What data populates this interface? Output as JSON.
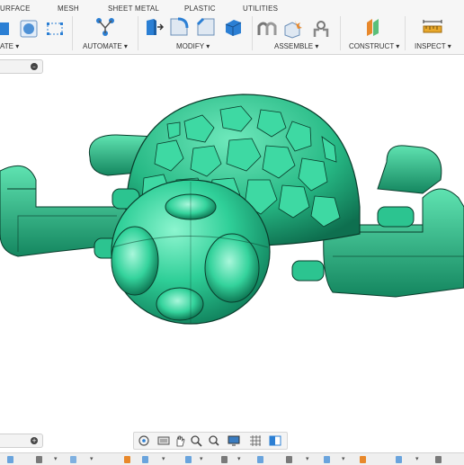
{
  "tabs": [
    "URFACE",
    "MESH",
    "SHEET METAL",
    "PLASTIC",
    "UTILITIES"
  ],
  "groups": {
    "create": "ATE ▾",
    "automate": "AUTOMATE ▾",
    "modify": "MODIFY ▾",
    "assemble": "ASSEMBLE ▾",
    "construct": "CONSTRUCT ▾",
    "inspect": "INSPECT ▾"
  },
  "panels": {
    "browser_toggle": "–",
    "comments_toggle": "+"
  },
  "colors": {
    "model_fill": "#2fcf98",
    "model_light": "#7ff0c6",
    "model_dark": "#0e7a57",
    "edge": "#0a3d2c",
    "accent_blue": "#2b7fd4",
    "accent_orange": "#e8882b"
  },
  "icons": {
    "navbar": [
      "orbit-icon",
      "display-icon",
      "pan-icon",
      "zoom-icon",
      "zoom-window-icon",
      "display-settings-icon",
      "grid-icon",
      "viewports-icon"
    ]
  }
}
